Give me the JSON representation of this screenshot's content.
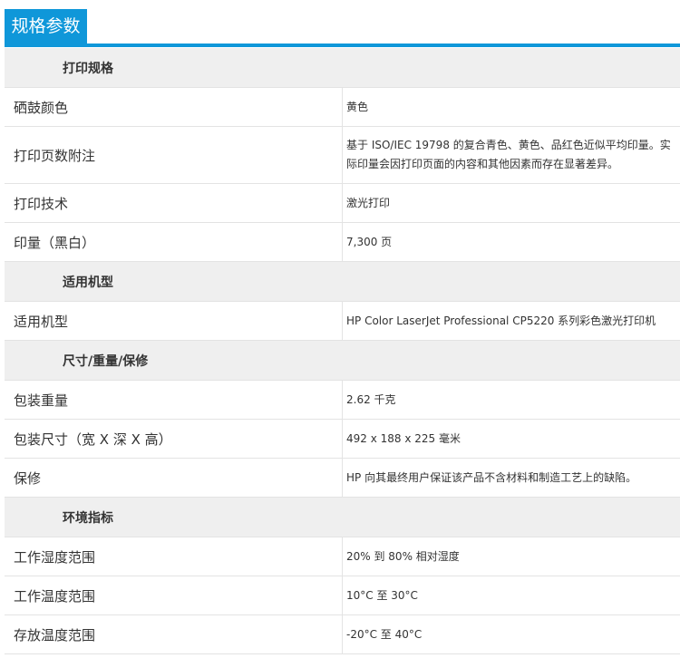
{
  "header": {
    "title": "规格参数"
  },
  "sections": [
    {
      "title": "打印规格",
      "rows": [
        {
          "label": "硒鼓颜色",
          "value": "黄色"
        },
        {
          "label": "打印页数附注",
          "value": "基于 ISO/IEC 19798 的复合青色、黄色、品红色近似平均印量。实际印量会因打印页面的内容和其他因素而存在显著差异。"
        },
        {
          "label": "打印技术",
          "value": "激光打印"
        },
        {
          "label": "印量（黑白）",
          "value": "7,300 页"
        }
      ]
    },
    {
      "title": "适用机型",
      "rows": [
        {
          "label": "适用机型",
          "value": "HP Color LaserJet Professional CP5220 系列彩色激光打印机"
        }
      ]
    },
    {
      "title": "尺寸/重量/保修",
      "rows": [
        {
          "label": "包装重量",
          "value": "2.62 千克"
        },
        {
          "label": "包装尺寸（宽 X 深 X 高）",
          "value": "492 x 188 x 225 毫米"
        },
        {
          "label": "保修",
          "value": "HP 向其最终用户保证该产品不含材料和制造工艺上的缺陷。"
        }
      ]
    },
    {
      "title": "环境指标",
      "rows": [
        {
          "label": "工作湿度范围",
          "value": "20% 到 80% 相对湿度"
        },
        {
          "label": "工作温度范围",
          "value": "10°C 至 30°C"
        },
        {
          "label": "存放温度范围",
          "value": "-20°C 至 40°C"
        }
      ]
    }
  ]
}
